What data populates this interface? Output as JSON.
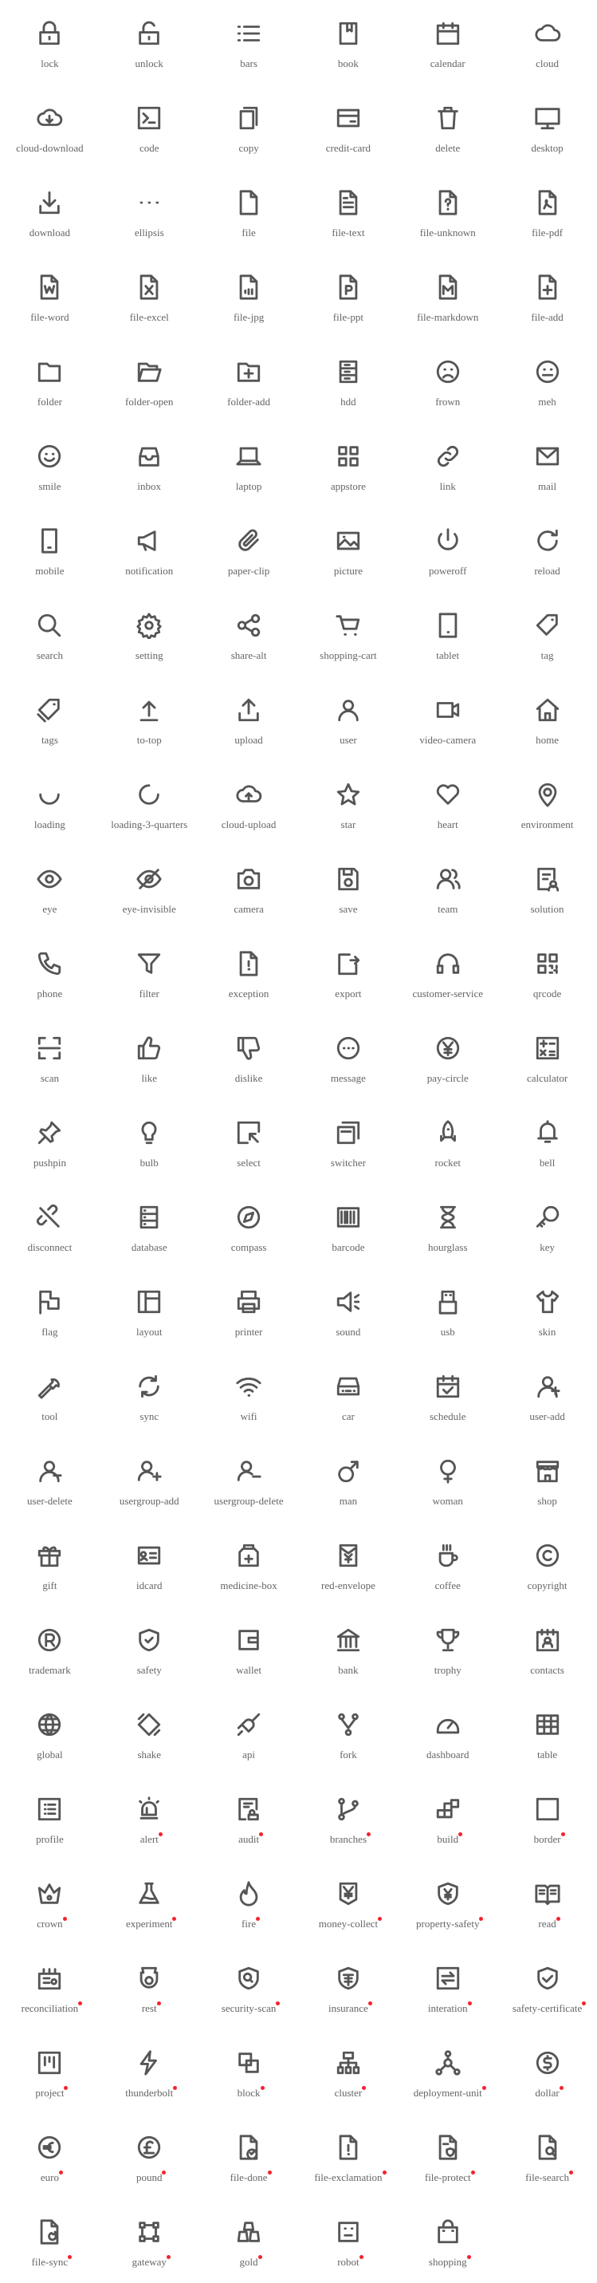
{
  "colors": {
    "icon": "#555555",
    "label": "#666666",
    "new_dot": "#f5222d"
  },
  "icons": [
    {
      "name": "lock"
    },
    {
      "name": "unlock"
    },
    {
      "name": "bars"
    },
    {
      "name": "book"
    },
    {
      "name": "calendar"
    },
    {
      "name": "cloud"
    },
    {
      "name": "cloud-download"
    },
    {
      "name": "code"
    },
    {
      "name": "copy"
    },
    {
      "name": "credit-card"
    },
    {
      "name": "delete"
    },
    {
      "name": "desktop"
    },
    {
      "name": "download"
    },
    {
      "name": "ellipsis"
    },
    {
      "name": "file"
    },
    {
      "name": "file-text"
    },
    {
      "name": "file-unknown"
    },
    {
      "name": "file-pdf"
    },
    {
      "name": "file-word"
    },
    {
      "name": "file-excel"
    },
    {
      "name": "file-jpg"
    },
    {
      "name": "file-ppt"
    },
    {
      "name": "file-markdown"
    },
    {
      "name": "file-add"
    },
    {
      "name": "folder"
    },
    {
      "name": "folder-open"
    },
    {
      "name": "folder-add"
    },
    {
      "name": "hdd"
    },
    {
      "name": "frown"
    },
    {
      "name": "meh"
    },
    {
      "name": "smile"
    },
    {
      "name": "inbox"
    },
    {
      "name": "laptop"
    },
    {
      "name": "appstore"
    },
    {
      "name": "link"
    },
    {
      "name": "mail"
    },
    {
      "name": "mobile"
    },
    {
      "name": "notification"
    },
    {
      "name": "paper-clip"
    },
    {
      "name": "picture"
    },
    {
      "name": "poweroff"
    },
    {
      "name": "reload"
    },
    {
      "name": "search"
    },
    {
      "name": "setting"
    },
    {
      "name": "share-alt"
    },
    {
      "name": "shopping-cart"
    },
    {
      "name": "tablet"
    },
    {
      "name": "tag"
    },
    {
      "name": "tags"
    },
    {
      "name": "to-top"
    },
    {
      "name": "upload"
    },
    {
      "name": "user"
    },
    {
      "name": "video-camera"
    },
    {
      "name": "home"
    },
    {
      "name": "loading"
    },
    {
      "name": "loading-3-quarters"
    },
    {
      "name": "cloud-upload"
    },
    {
      "name": "star"
    },
    {
      "name": "heart"
    },
    {
      "name": "environment"
    },
    {
      "name": "eye"
    },
    {
      "name": "eye-invisible"
    },
    {
      "name": "camera"
    },
    {
      "name": "save"
    },
    {
      "name": "team"
    },
    {
      "name": "solution"
    },
    {
      "name": "phone"
    },
    {
      "name": "filter"
    },
    {
      "name": "exception"
    },
    {
      "name": "export"
    },
    {
      "name": "customer-service"
    },
    {
      "name": "qrcode"
    },
    {
      "name": "scan"
    },
    {
      "name": "like"
    },
    {
      "name": "dislike"
    },
    {
      "name": "message"
    },
    {
      "name": "pay-circle"
    },
    {
      "name": "calculator"
    },
    {
      "name": "pushpin"
    },
    {
      "name": "bulb"
    },
    {
      "name": "select"
    },
    {
      "name": "switcher"
    },
    {
      "name": "rocket"
    },
    {
      "name": "bell"
    },
    {
      "name": "disconnect"
    },
    {
      "name": "database"
    },
    {
      "name": "compass"
    },
    {
      "name": "barcode"
    },
    {
      "name": "hourglass"
    },
    {
      "name": "key"
    },
    {
      "name": "flag"
    },
    {
      "name": "layout"
    },
    {
      "name": "printer"
    },
    {
      "name": "sound"
    },
    {
      "name": "usb"
    },
    {
      "name": "skin"
    },
    {
      "name": "tool"
    },
    {
      "name": "sync"
    },
    {
      "name": "wifi"
    },
    {
      "name": "car"
    },
    {
      "name": "schedule"
    },
    {
      "name": "user-add"
    },
    {
      "name": "user-delete"
    },
    {
      "name": "usergroup-add"
    },
    {
      "name": "usergroup-delete"
    },
    {
      "name": "man"
    },
    {
      "name": "woman"
    },
    {
      "name": "shop"
    },
    {
      "name": "gift"
    },
    {
      "name": "idcard"
    },
    {
      "name": "medicine-box"
    },
    {
      "name": "red-envelope"
    },
    {
      "name": "coffee"
    },
    {
      "name": "copyright"
    },
    {
      "name": "trademark"
    },
    {
      "name": "safety"
    },
    {
      "name": "wallet"
    },
    {
      "name": "bank"
    },
    {
      "name": "trophy"
    },
    {
      "name": "contacts"
    },
    {
      "name": "global"
    },
    {
      "name": "shake"
    },
    {
      "name": "api"
    },
    {
      "name": "fork"
    },
    {
      "name": "dashboard"
    },
    {
      "name": "table"
    },
    {
      "name": "profile"
    },
    {
      "name": "alert",
      "new": true
    },
    {
      "name": "audit",
      "new": true
    },
    {
      "name": "branches",
      "new": true
    },
    {
      "name": "build",
      "new": true
    },
    {
      "name": "border",
      "new": true
    },
    {
      "name": "crown",
      "new": true
    },
    {
      "name": "experiment",
      "new": true
    },
    {
      "name": "fire",
      "new": true
    },
    {
      "name": "money-collect",
      "new": true
    },
    {
      "name": "property-safety",
      "new": true
    },
    {
      "name": "read",
      "new": true
    },
    {
      "name": "reconciliation",
      "new": true
    },
    {
      "name": "rest",
      "new": true
    },
    {
      "name": "security-scan",
      "new": true
    },
    {
      "name": "insurance",
      "new": true
    },
    {
      "name": "interation",
      "new": true
    },
    {
      "name": "safety-certificate",
      "new": true
    },
    {
      "name": "project",
      "new": true
    },
    {
      "name": "thunderbolt",
      "new": true
    },
    {
      "name": "block",
      "new": true
    },
    {
      "name": "cluster",
      "new": true
    },
    {
      "name": "deployment-unit",
      "new": true
    },
    {
      "name": "dollar",
      "new": true
    },
    {
      "name": "euro",
      "new": true
    },
    {
      "name": "pound",
      "new": true
    },
    {
      "name": "file-done",
      "new": true
    },
    {
      "name": "file-exclamation",
      "new": true
    },
    {
      "name": "file-protect",
      "new": true
    },
    {
      "name": "file-search",
      "new": true
    },
    {
      "name": "file-sync",
      "new": true
    },
    {
      "name": "gateway",
      "new": true
    },
    {
      "name": "gold",
      "new": true
    },
    {
      "name": "robot",
      "new": true
    },
    {
      "name": "shopping",
      "new": true
    }
  ]
}
